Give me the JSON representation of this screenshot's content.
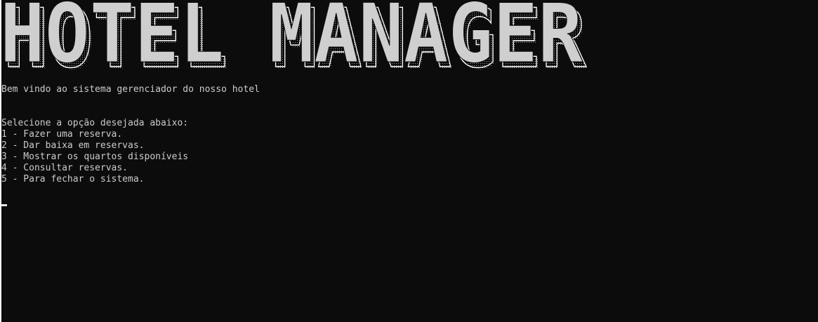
{
  "window": {
    "background": "#0c0c0c",
    "text_color": "#cccccc"
  },
  "banner": {
    "text": "HOTEL MANAGER",
    "fill_color": "#cfcfcf",
    "shadow_color": "#ffffff"
  },
  "intro": {
    "welcome": "Bem vindo ao sistema gerenciador do nosso hotel"
  },
  "menu": {
    "prompt": "Selecione a opção desejada abaixo:",
    "options": [
      "1 - Fazer uma reserva.",
      "2 - Dar baixa em reservas.",
      "3 - Mostrar os quartos disponíveis",
      "4 - Consultar reservas.",
      "5 - Para fechar o sistema."
    ]
  }
}
